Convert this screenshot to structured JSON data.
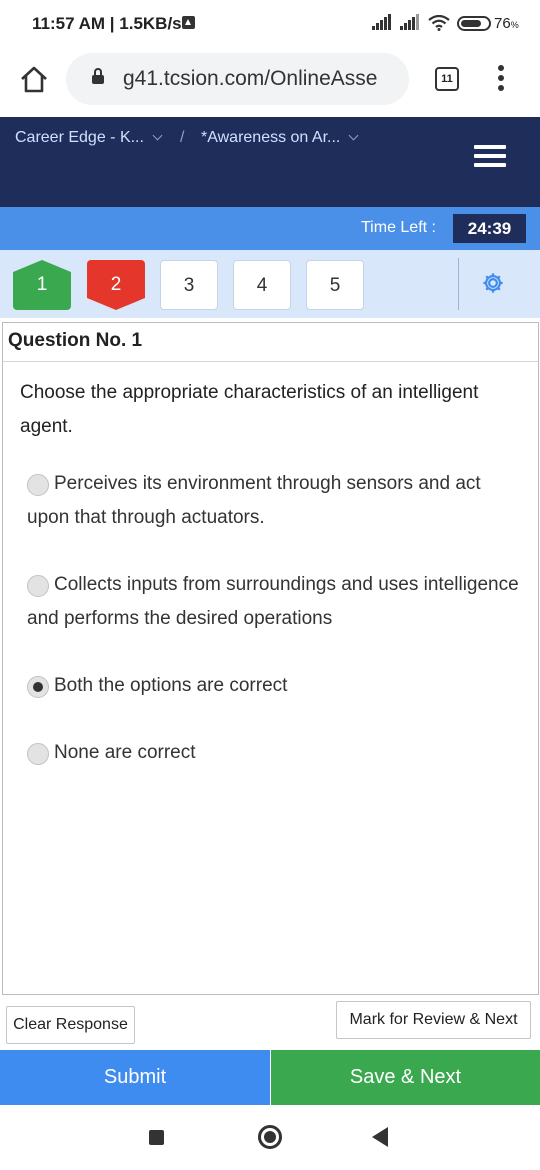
{
  "status_bar": {
    "time": "11:57 AM | 1.5KB/s",
    "battery": "76",
    "battery_unit": "%",
    "battery_level": 0.76,
    "icons": [
      "upload-arrow-icon",
      "signal-icon",
      "signal-icon",
      "wifi-icon",
      "battery-icon"
    ]
  },
  "browser": {
    "url": "g41.tcsion.com/OnlineAsse",
    "tab_count": "11",
    "icons": [
      "home-icon",
      "lock-icon",
      "tabs-icon",
      "more-vert-icon"
    ]
  },
  "header": {
    "crumb_1": "Career Edge - K...",
    "crumb_separator": "/",
    "crumb_2": "*Awareness on Ar...",
    "menu_icon": "hamburger-icon",
    "background": "#1f2d5a"
  },
  "timer": {
    "label": "Time Left :",
    "value": "24:39"
  },
  "palette": {
    "questions": [
      {
        "number": "1",
        "status": "answered"
      },
      {
        "number": "2",
        "status": "not-answered"
      },
      {
        "number": "3",
        "status": "not-visited"
      },
      {
        "number": "4",
        "status": "not-visited"
      },
      {
        "number": "5",
        "status": "not-visited"
      }
    ],
    "settings_icon": "gear-icon",
    "colors": {
      "answered": "#3aa84f",
      "not_answered": "#e5362b",
      "accent": "#4a90e8"
    }
  },
  "question": {
    "title": "Question No. 1",
    "text": "Choose the appropriate characteristics of an intelligent agent.",
    "options": [
      {
        "label": "Perceives its environment through sensors and act upon that through actuators.",
        "selected": false
      },
      {
        "label": "Collects inputs from surroundings and uses intelligence and performs the desired operations",
        "selected": false
      },
      {
        "label": "Both the options are correct",
        "selected": true
      },
      {
        "label": "None are correct",
        "selected": false
      }
    ]
  },
  "actions": {
    "clear": "Clear Response",
    "mark_review": "Mark for Review & Next",
    "submit": "Submit",
    "save_next": "Save & Next"
  },
  "nav": {
    "icons": [
      "recents-icon",
      "home-circle-icon",
      "back-icon"
    ]
  }
}
